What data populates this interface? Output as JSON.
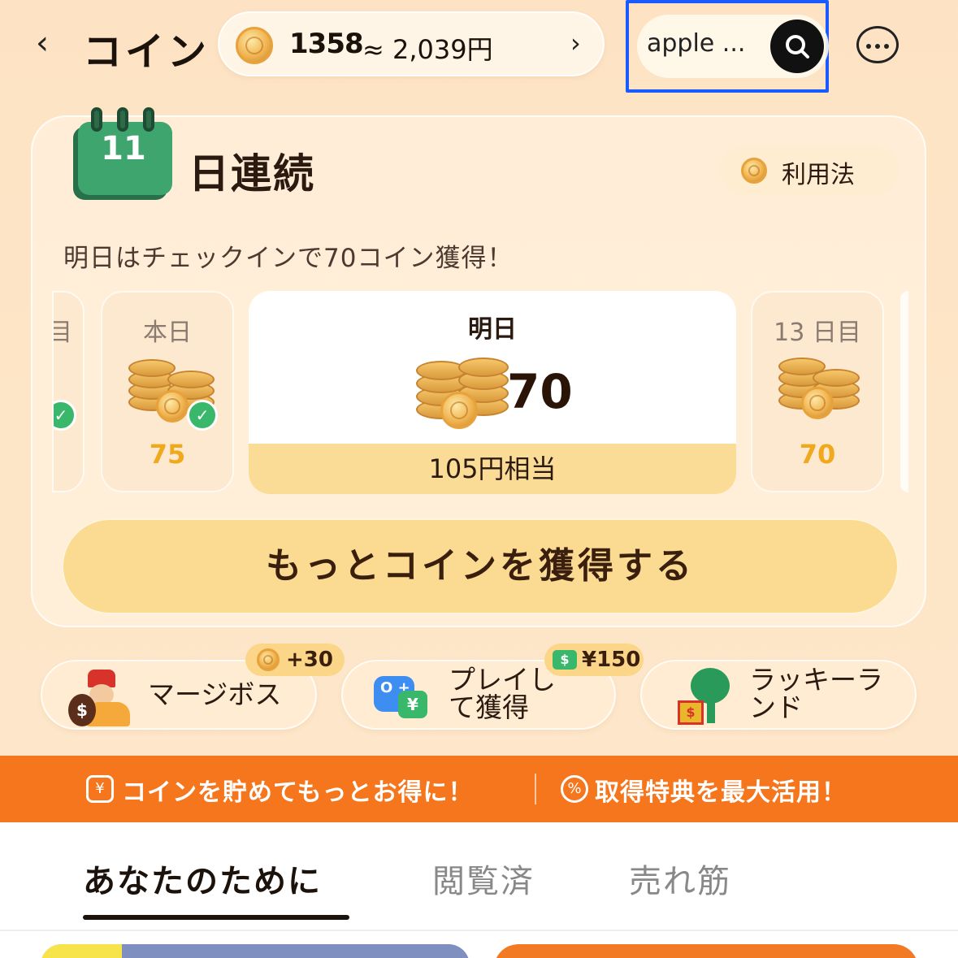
{
  "header": {
    "title": "コイン",
    "balance_coins": "1358",
    "balance_approx": "≈ 2,039円",
    "search_text": "apple ...",
    "icons": [
      "back-chevron-icon",
      "coin-icon",
      "chevron-right-icon",
      "search-icon",
      "more-icon"
    ]
  },
  "checkin": {
    "streak_days": "11",
    "streak_label": "日連続",
    "usage_label": "利用法",
    "tomorrow_message": "明日はチェックインで70コイン獲得！",
    "prev_label": "目",
    "days": [
      {
        "label": "本日",
        "value": "75",
        "checked": true
      },
      {
        "label": "明日",
        "value": "70",
        "yen": "105円相当"
      },
      {
        "label": "13 日目",
        "value": "70"
      }
    ],
    "earn_more_label": "もっとコインを獲得する"
  },
  "features": [
    {
      "label": "マージボス",
      "badge": "+30"
    },
    {
      "label": "プレイして獲得",
      "badge": "¥150"
    },
    {
      "label": "ラッキーランド"
    }
  ],
  "feature_lines": {
    "play_1": "プレイし",
    "play_2": "て獲得",
    "lucky_1": "ラッキーラ",
    "lucky_2": "ンド"
  },
  "promo": {
    "left": "コインを貯めてもっとお得に！",
    "right": "取得特典を最大活用！"
  },
  "tabs": [
    "あなたのために",
    "閲覧済",
    "売れ筋"
  ],
  "colors": {
    "accent_orange": "#f5761c",
    "highlight_blue": "#1a5bff",
    "coin_gold": "#f0a81c",
    "check_green": "#39b86b"
  }
}
